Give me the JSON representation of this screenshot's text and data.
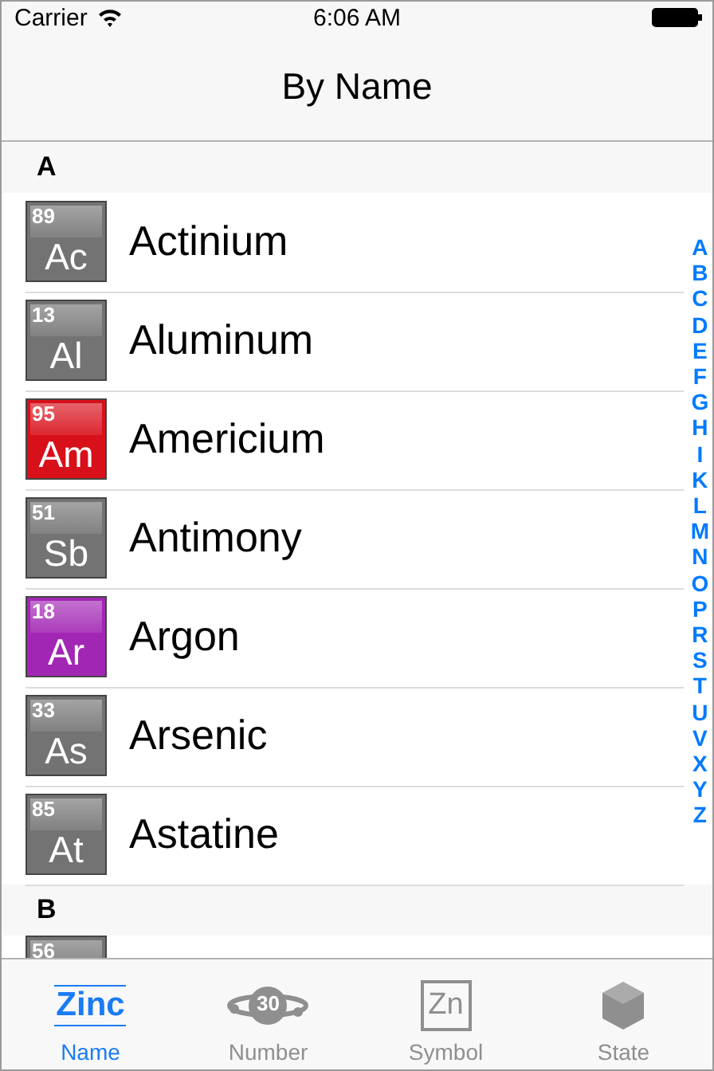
{
  "status_bar": {
    "carrier": "Carrier",
    "time": "6:06 AM"
  },
  "nav": {
    "title": "By Name"
  },
  "sections": [
    {
      "letter": "A",
      "rows": [
        {
          "number": "89",
          "symbol": "Ac",
          "name": "Actinium",
          "color": "#737373"
        },
        {
          "number": "13",
          "symbol": "Al",
          "name": "Aluminum",
          "color": "#737373"
        },
        {
          "number": "95",
          "symbol": "Am",
          "name": "Americium",
          "color": "#d8101a"
        },
        {
          "number": "51",
          "symbol": "Sb",
          "name": "Antimony",
          "color": "#737373"
        },
        {
          "number": "18",
          "symbol": "Ar",
          "name": "Argon",
          "color": "#a226b4"
        },
        {
          "number": "33",
          "symbol": "As",
          "name": "Arsenic",
          "color": "#737373"
        },
        {
          "number": "85",
          "symbol": "At",
          "name": "Astatine",
          "color": "#737373"
        }
      ]
    },
    {
      "letter": "B",
      "rows": [
        {
          "number": "56",
          "color": "#737373"
        }
      ]
    }
  ],
  "index": [
    "A",
    "B",
    "C",
    "D",
    "E",
    "F",
    "G",
    "H",
    "I",
    "K",
    "L",
    "M",
    "N",
    "O",
    "P",
    "R",
    "S",
    "T",
    "U",
    "V",
    "X",
    "Y",
    "Z"
  ],
  "tabs": [
    {
      "label": "Name",
      "kind": "word",
      "icon_text": "Zinc",
      "selected": true
    },
    {
      "label": "Number",
      "kind": "orbit",
      "icon_text": "30",
      "selected": false
    },
    {
      "label": "Symbol",
      "kind": "box",
      "icon_text": "Zn",
      "selected": false
    },
    {
      "label": "State",
      "kind": "cube",
      "selected": false
    }
  ]
}
